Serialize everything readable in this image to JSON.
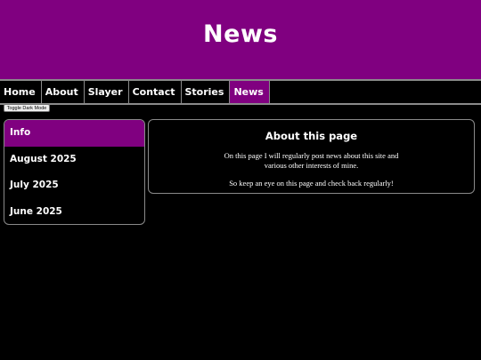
{
  "header": {
    "title": "News"
  },
  "nav": {
    "items": [
      {
        "label": "Home"
      },
      {
        "label": "About"
      },
      {
        "label": "Slayer"
      },
      {
        "label": "Contact"
      },
      {
        "label": "Stories"
      },
      {
        "label": "News"
      }
    ],
    "active": "News"
  },
  "toggle": {
    "label": "Toggle Dark Mode"
  },
  "sidebar": {
    "items": [
      {
        "label": "Info"
      },
      {
        "label": "August 2025"
      },
      {
        "label": "July 2025"
      },
      {
        "label": "June 2025"
      }
    ],
    "active": "Info"
  },
  "main": {
    "title": "About this page",
    "paragraph1": "On this page I will regularly post news about this site and various other interests of mine.",
    "paragraph2": "So keep an eye on this page and check back regularly!"
  },
  "colors": {
    "accent": "#800080",
    "background": "#000000",
    "border": "#8a8a8a",
    "text": "#ffffff"
  }
}
